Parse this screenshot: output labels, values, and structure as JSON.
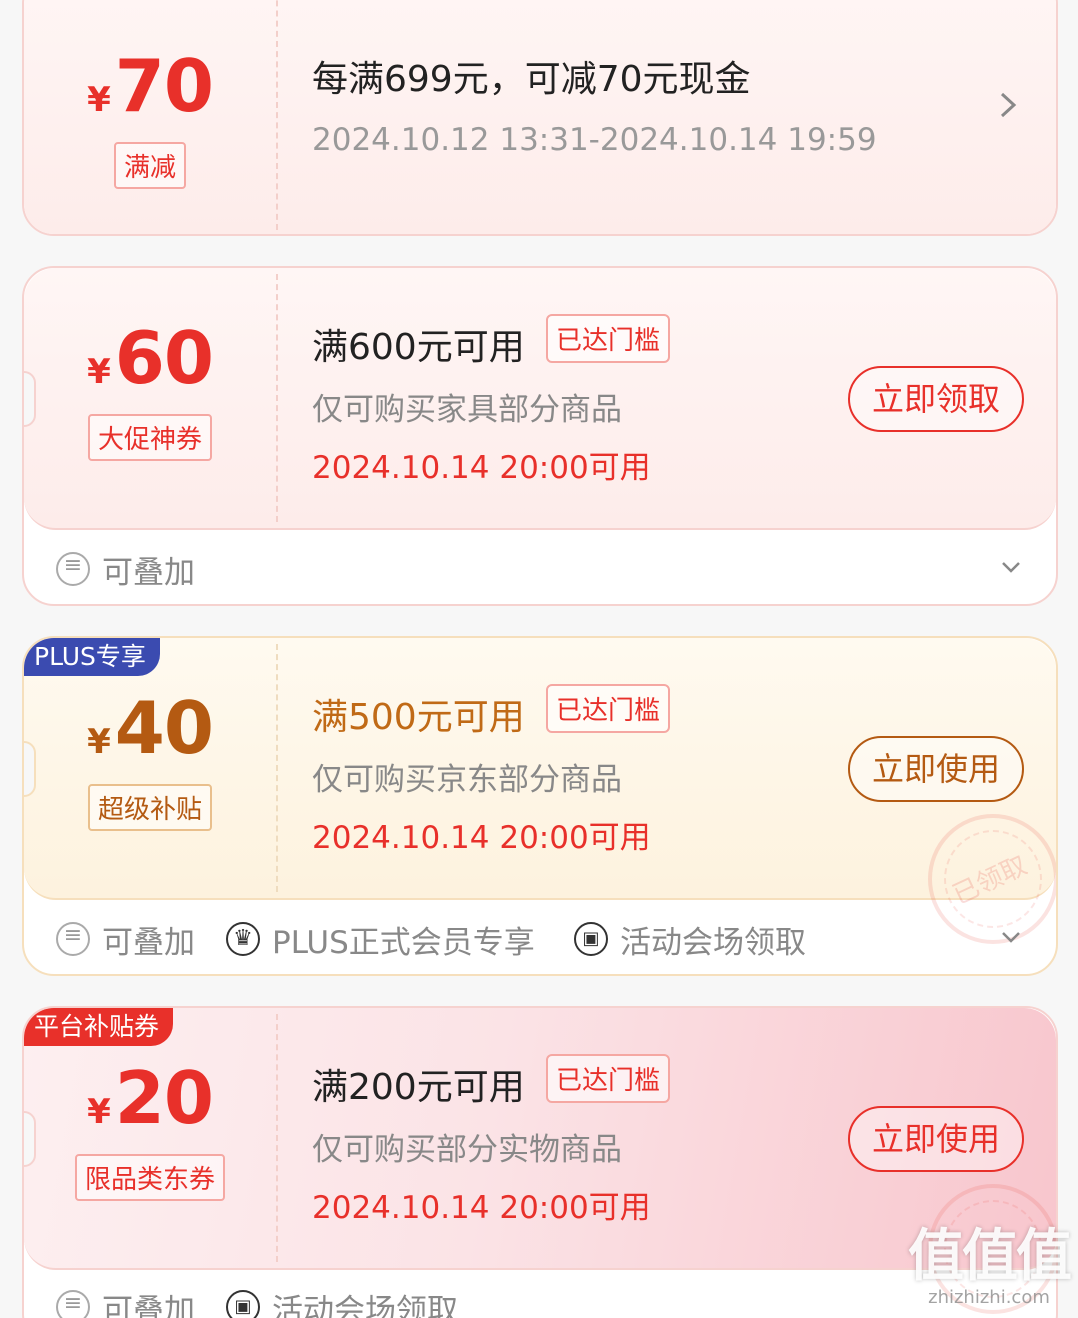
{
  "coupons": [
    {
      "currency": "¥",
      "amount": "70",
      "tag": "满减",
      "title": "每满699元，可减70元现金",
      "time": "2024.10.12 13:31-2024.10.14 19:59"
    },
    {
      "currency": "¥",
      "amount": "60",
      "tag": "大促神券",
      "title": "满600元可用",
      "badge": "已达门槛",
      "desc": "仅可购买家具部分商品",
      "time": "2024.10.14 20:00可用",
      "button": "立即领取",
      "features": [
        "可叠加"
      ]
    },
    {
      "ribbon": "PLUS专享",
      "currency": "¥",
      "amount": "40",
      "tag": "超级补贴",
      "title": "满500元可用",
      "badge": "已达门槛",
      "desc": "仅可购买京东部分商品",
      "time": "2024.10.14 20:00可用",
      "button": "立即使用",
      "stamp": "已领取",
      "features": [
        "可叠加",
        "PLUS正式会员专享",
        "活动会场领取"
      ]
    },
    {
      "ribbon": "平台补贴券",
      "currency": "¥",
      "amount": "20",
      "tag": "限品类东券",
      "title": "满200元可用",
      "badge": "已达门槛",
      "desc": "仅可购买部分实物商品",
      "time": "2024.10.14 20:00可用",
      "button": "立即使用",
      "features": [
        "可叠加",
        "活动会场领取"
      ]
    }
  ],
  "watermark": {
    "logo": "值值值",
    "site": "zhizhizhi.com"
  }
}
